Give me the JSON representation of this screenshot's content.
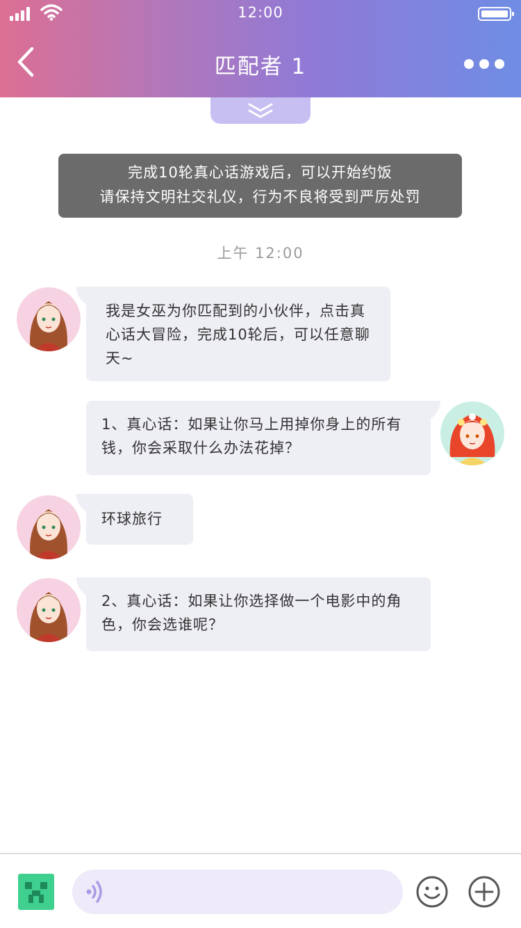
{
  "status_bar": {
    "time": "12:00"
  },
  "nav": {
    "title": "匹配者 1",
    "back_icon": "chevron-left-icon",
    "more_icon": "more-dots-icon"
  },
  "notice": {
    "line1": "完成10轮真心话游戏后，可以开始约饭",
    "line2": "请保持文明社交礼仪，行为不良将受到严厉处罚"
  },
  "timestamp": "上午 12:00",
  "messages": [
    {
      "sender": "left",
      "text": "我是女巫为你匹配到的小伙伴，点击真心话大冒险，完成10轮后，可以任意聊天~"
    },
    {
      "sender": "right",
      "text": "1、真心话：如果让你马上用掉你身上的所有钱，你会采取什么办法花掉？"
    },
    {
      "sender": "left",
      "text": "环球旅行"
    },
    {
      "sender": "left",
      "text": "2、真心话：如果让你选择做一个电影中的角色，你会选谁呢？"
    }
  ],
  "input_bar": {
    "placeholder": "",
    "value": ""
  },
  "colors": {
    "header_gradient_start": "#dc6f93",
    "header_gradient_end": "#6f8de4",
    "bubble_bg": "#eeeef5",
    "notice_bg": "#6b6b6b",
    "pull_tab": "#c7bff1",
    "app_icon": "#3fcf8e",
    "input_bg": "#eeeaf9"
  }
}
